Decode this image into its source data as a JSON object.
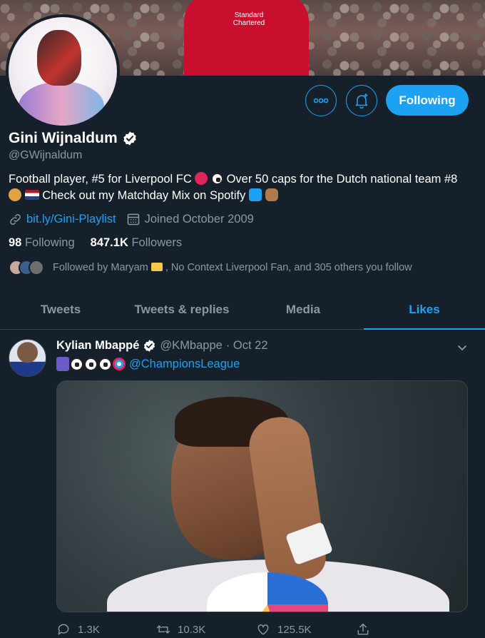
{
  "banner": {
    "sponsor_text": "Standard Chartered"
  },
  "profile": {
    "display_name": "Gini Wijnaldum",
    "handle": "@GWijnaldum",
    "bio_part1": "Football player, #5 for Liverpool FC",
    "bio_part2": "Over 50 caps for the Dutch national team #8",
    "bio_part3": "Check out my Matchday Mix on Spotify",
    "link": "bit.ly/Gini-Playlist",
    "joined": "Joined October 2009",
    "following_count": "98",
    "following_label": "Following",
    "followers_count": "847.1K",
    "followers_label": "Followers",
    "followed_by": "Followed by Maryam",
    "followed_by_rest": ", No Context Liverpool Fan, and 305 others you follow"
  },
  "actions": {
    "more_icon": "more-dots-icon",
    "notify_icon": "bell-plus-icon",
    "follow_label": "Following"
  },
  "tabs": [
    {
      "label": "Tweets"
    },
    {
      "label": "Tweets & replies"
    },
    {
      "label": "Media"
    },
    {
      "label": "Likes"
    }
  ],
  "tweet": {
    "author": "Kylian Mbappé",
    "handle": "@KMbappe",
    "date": "· Oct 22",
    "mention": "@ChampionsLeague",
    "replies": "1.3K",
    "retweets": "10.3K",
    "likes": "125.5K"
  },
  "colors": {
    "background": "#15202b",
    "accent": "#1da1f2",
    "muted": "#8899a6"
  }
}
